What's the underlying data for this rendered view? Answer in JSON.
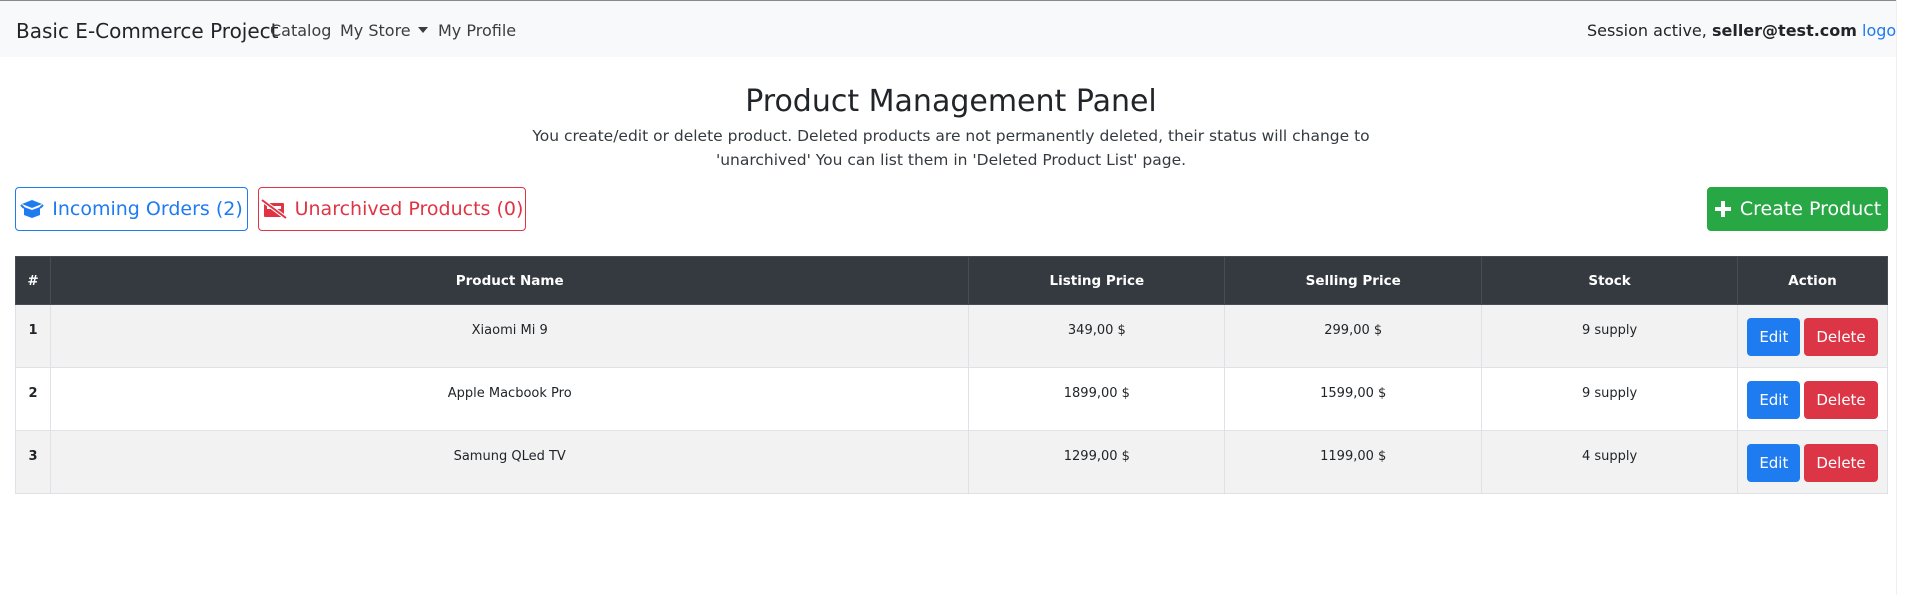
{
  "navbar": {
    "brand": "Basic E-Commerce Project",
    "links": {
      "catalog": "Catalog",
      "my_store": "My Store",
      "my_profile": "My Profile"
    },
    "session": {
      "prefix": "Session active,",
      "email": "seller@test.com",
      "logout": "logout."
    }
  },
  "page": {
    "title": "Product Management Panel",
    "description": "You create/edit or delete product. Deleted products are not permanently deleted, their status will change to 'unarchived' You can list them in 'Deleted Product List' page."
  },
  "actions": {
    "incoming_orders": "Incoming Orders (2)",
    "unarchived_products": "Unarchived Products (0)",
    "create_product": "Create Product"
  },
  "table": {
    "headers": [
      "#",
      "Product Name",
      "Listing Price",
      "Selling Price",
      "Stock",
      "Action"
    ],
    "rows": [
      {
        "index": "1",
        "name": "Xiaomi Mi 9",
        "listing_price": "349,00 $",
        "selling_price": "299,00 $",
        "stock": "9 supply"
      },
      {
        "index": "2",
        "name": "Apple Macbook Pro",
        "listing_price": "1899,00 $",
        "selling_price": "1599,00 $",
        "stock": "9 supply"
      },
      {
        "index": "3",
        "name": "Samung QLed TV",
        "listing_price": "1299,00 $",
        "selling_price": "1199,00 $",
        "stock": "4 supply"
      }
    ],
    "edit_label": "Edit",
    "delete_label": "Delete"
  },
  "icons": {
    "incoming_orders": "box-open-icon",
    "unarchived_products": "crossed-box-icon",
    "create_product": "plus-icon"
  },
  "colors": {
    "primary": "#1e7bf0",
    "danger": "#dc3545",
    "success": "#28a745",
    "dark": "#343a40"
  }
}
